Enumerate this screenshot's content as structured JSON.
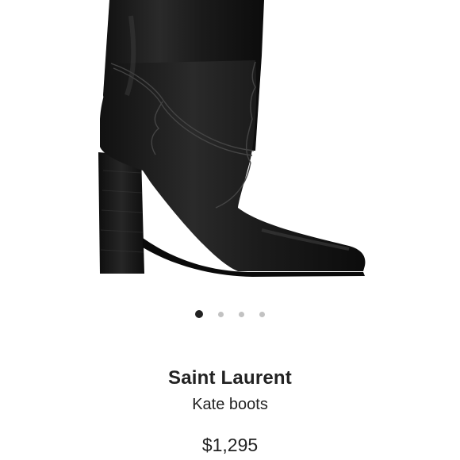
{
  "product": {
    "brand": "Saint Laurent",
    "name": "Kate boots",
    "price": "$1,295",
    "image_icon": "boot-image"
  },
  "carousel": {
    "dot_count": 4,
    "active_index": 0,
    "active_color": "#222222",
    "inactive_color": "#c2c2c2"
  }
}
